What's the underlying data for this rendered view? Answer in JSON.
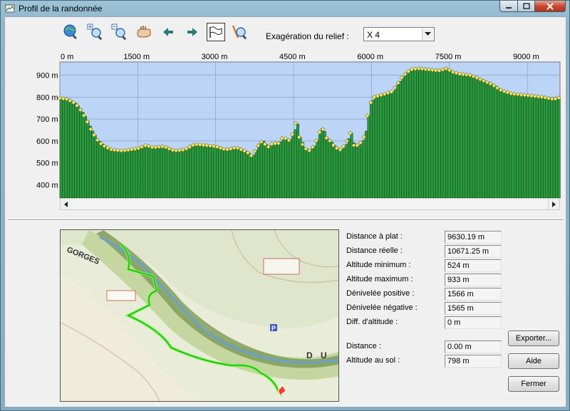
{
  "window": {
    "title": "Profil de la randonnée"
  },
  "toolbar": {
    "buttons": [
      {
        "name": "zoom-globe-icon"
      },
      {
        "name": "zoom-in-icon"
      },
      {
        "name": "zoom-out-icon"
      },
      {
        "name": "pan-hand-icon"
      },
      {
        "name": "arrow-left-icon"
      },
      {
        "name": "arrow-right-icon"
      },
      {
        "name": "profile-flag-icon",
        "pressed": true
      },
      {
        "name": "map-zoom-icon"
      }
    ],
    "exaggeration_label": "Exagération du relief :",
    "exaggeration_value": "X 4"
  },
  "chart_data": {
    "type": "bar",
    "x_unit": "m",
    "x_ticks": [
      "0 m",
      "1500 m",
      "3000 m",
      "4500 m",
      "6000 m",
      "7500 m",
      "9000 m"
    ],
    "y_ticks": [
      "900 m",
      "800 m",
      "700 m",
      "600 m",
      "500 m",
      "400 m"
    ],
    "xlim": [
      0,
      9630
    ],
    "ylim": [
      340,
      960
    ],
    "colors": {
      "plot_bg": "#bcd4f5",
      "bar": "#2a9a3e",
      "point": "#f5ea6a",
      "grid": "#7f97bc"
    },
    "profile": [
      [
        0,
        795
      ],
      [
        150,
        790
      ],
      [
        300,
        770
      ],
      [
        400,
        740
      ],
      [
        500,
        700
      ],
      [
        600,
        650
      ],
      [
        700,
        610
      ],
      [
        800,
        585
      ],
      [
        900,
        570
      ],
      [
        1000,
        560
      ],
      [
        1200,
        555
      ],
      [
        1500,
        565
      ],
      [
        1650,
        580
      ],
      [
        1800,
        570
      ],
      [
        2000,
        575
      ],
      [
        2200,
        555
      ],
      [
        2400,
        560
      ],
      [
        2600,
        585
      ],
      [
        2800,
        580
      ],
      [
        3000,
        575
      ],
      [
        3200,
        560
      ],
      [
        3400,
        570
      ],
      [
        3600,
        550
      ],
      [
        3700,
        530
      ],
      [
        3800,
        575
      ],
      [
        3900,
        600
      ],
      [
        4000,
        570
      ],
      [
        4100,
        590
      ],
      [
        4200,
        585
      ],
      [
        4300,
        620
      ],
      [
        4400,
        600
      ],
      [
        4500,
        640
      ],
      [
        4550,
        690
      ],
      [
        4600,
        620
      ],
      [
        4700,
        570
      ],
      [
        4800,
        555
      ],
      [
        4900,
        580
      ],
      [
        5000,
        640
      ],
      [
        5050,
        670
      ],
      [
        5100,
        620
      ],
      [
        5200,
        600
      ],
      [
        5300,
        570
      ],
      [
        5400,
        560
      ],
      [
        5500,
        585
      ],
      [
        5600,
        640
      ],
      [
        5650,
        580
      ],
      [
        5750,
        580
      ],
      [
        5850,
        610
      ],
      [
        5900,
        680
      ],
      [
        5950,
        760
      ],
      [
        6050,
        800
      ],
      [
        6200,
        810
      ],
      [
        6400,
        825
      ],
      [
        6500,
        860
      ],
      [
        6600,
        895
      ],
      [
        6750,
        925
      ],
      [
        6900,
        930
      ],
      [
        7100,
        925
      ],
      [
        7300,
        920
      ],
      [
        7450,
        930
      ],
      [
        7550,
        915
      ],
      [
        7700,
        905
      ],
      [
        7900,
        900
      ],
      [
        8100,
        880
      ],
      [
        8300,
        860
      ],
      [
        8500,
        830
      ],
      [
        8700,
        815
      ],
      [
        8900,
        810
      ],
      [
        9100,
        805
      ],
      [
        9300,
        800
      ],
      [
        9500,
        790
      ],
      [
        9630,
        798
      ]
    ]
  },
  "stats": [
    {
      "label": "Distance à plat :",
      "value": "9630.19 m"
    },
    {
      "label": "Distance réelle :",
      "value": "10671.25 m"
    },
    {
      "label": "Altitude minimum :",
      "value": "524 m"
    },
    {
      "label": "Altitude maximum :",
      "value": "933 m"
    },
    {
      "label": "Dénivelée positive :",
      "value": "1566 m"
    },
    {
      "label": "Dénivelée négative :",
      "value": "1565 m"
    },
    {
      "label": "Diff. d'altitude :",
      "value": "0 m"
    }
  ],
  "cursor_stats": [
    {
      "label": "Distance :",
      "value": "0.00 m"
    },
    {
      "label": "Altitude au sol :",
      "value": "798 m"
    }
  ],
  "buttons": {
    "export": "Exporter...",
    "help": "Aide",
    "close": "Fermer"
  },
  "map": {
    "labels": [
      "GORGES",
      "D",
      "U",
      "P"
    ]
  }
}
